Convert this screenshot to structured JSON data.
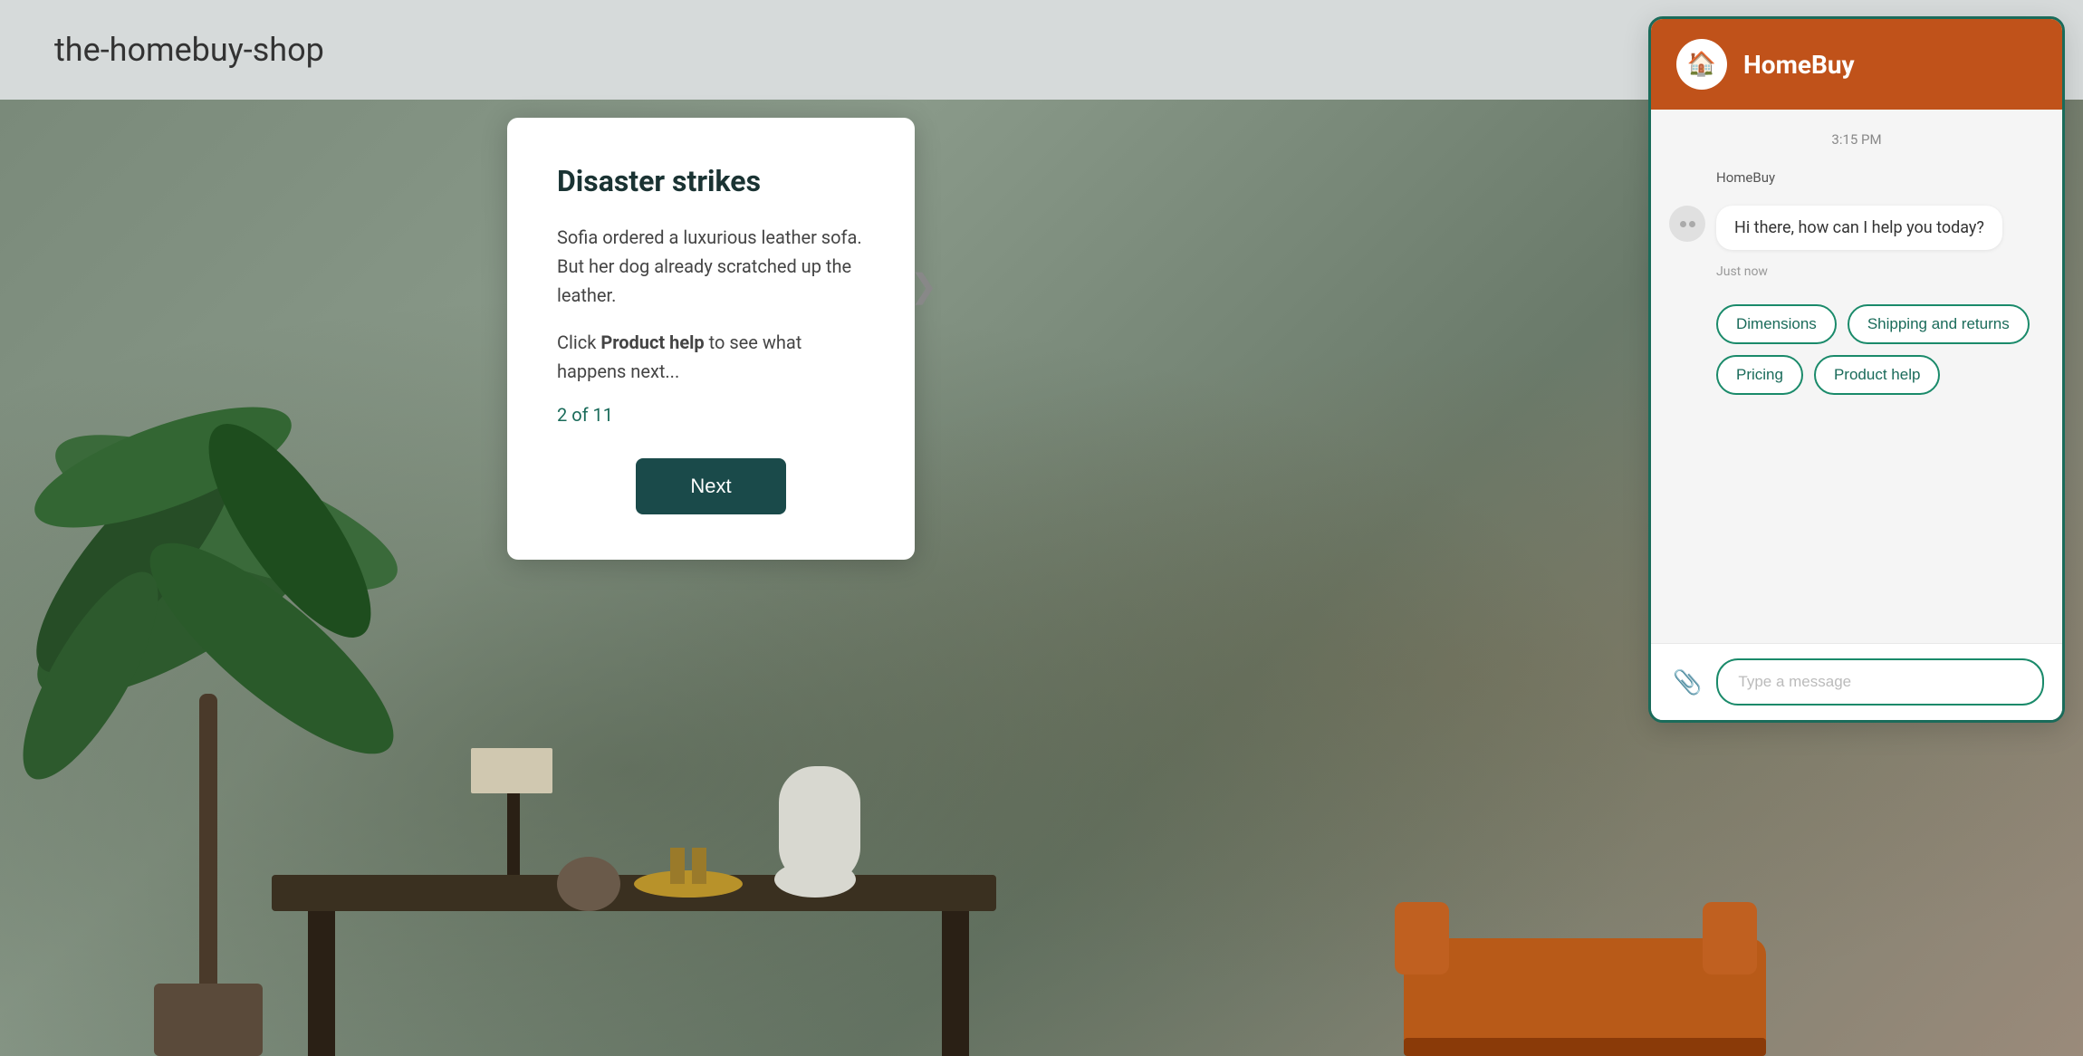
{
  "website": {
    "title": "the-homebuy-shop"
  },
  "modal": {
    "title": "Disaster strikes",
    "body_line1": "Sofia ordered a luxurious leather sofa. But her dog already scratched up the leather.",
    "body_line2_prefix": "Click ",
    "body_line2_highlight": "Product help",
    "body_line2_suffix": " to see what happens next...",
    "counter": "2 of 11",
    "next_button": "Next"
  },
  "chat": {
    "brand": "HomeBuy",
    "timestamp": "3:15 PM",
    "sender": "HomeBuy",
    "message": "Hi there, how can I help you today?",
    "just_now": "Just now",
    "options": [
      "Dimensions",
      "Shipping and returns",
      "Pricing",
      "Product help"
    ],
    "input_placeholder": "Type a message"
  },
  "icons": {
    "home": "🏠",
    "attach": "📎",
    "arrow": "❯"
  }
}
